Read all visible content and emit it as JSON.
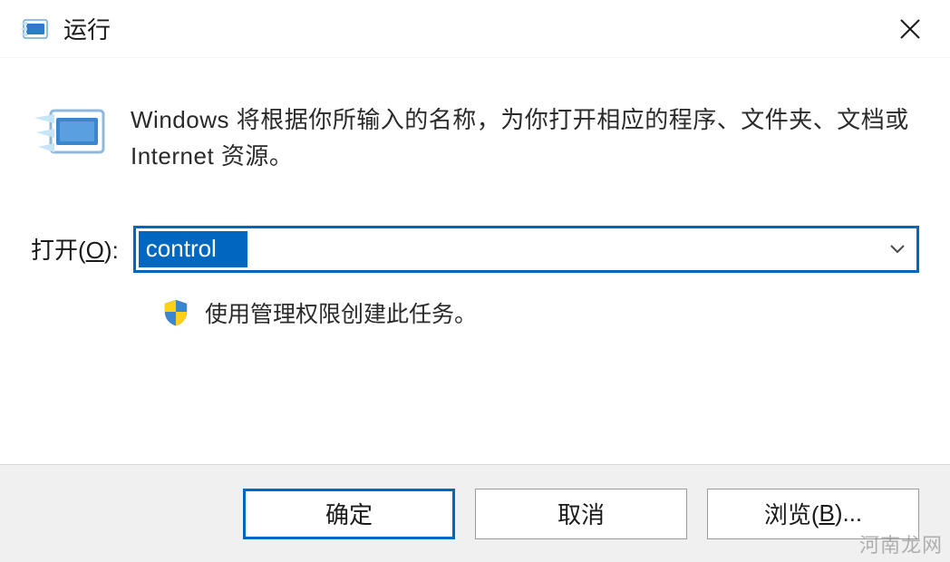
{
  "titlebar": {
    "title": "运行",
    "icon_name": "run-icon-small"
  },
  "content": {
    "description": "Windows 将根据你所输入的名称，为你打开相应的程序、文件夹、文档或 Internet 资源。",
    "open_label_prefix": "打开(",
    "open_label_mnemonic": "O",
    "open_label_suffix": "):",
    "input_value": "control",
    "admin_notice": "使用管理权限创建此任务。"
  },
  "buttons": {
    "ok_label": "确定",
    "cancel_label": "取消",
    "browse_prefix": "浏览(",
    "browse_mnemonic": "B",
    "browse_suffix": ")..."
  },
  "watermark": "河南龙网"
}
